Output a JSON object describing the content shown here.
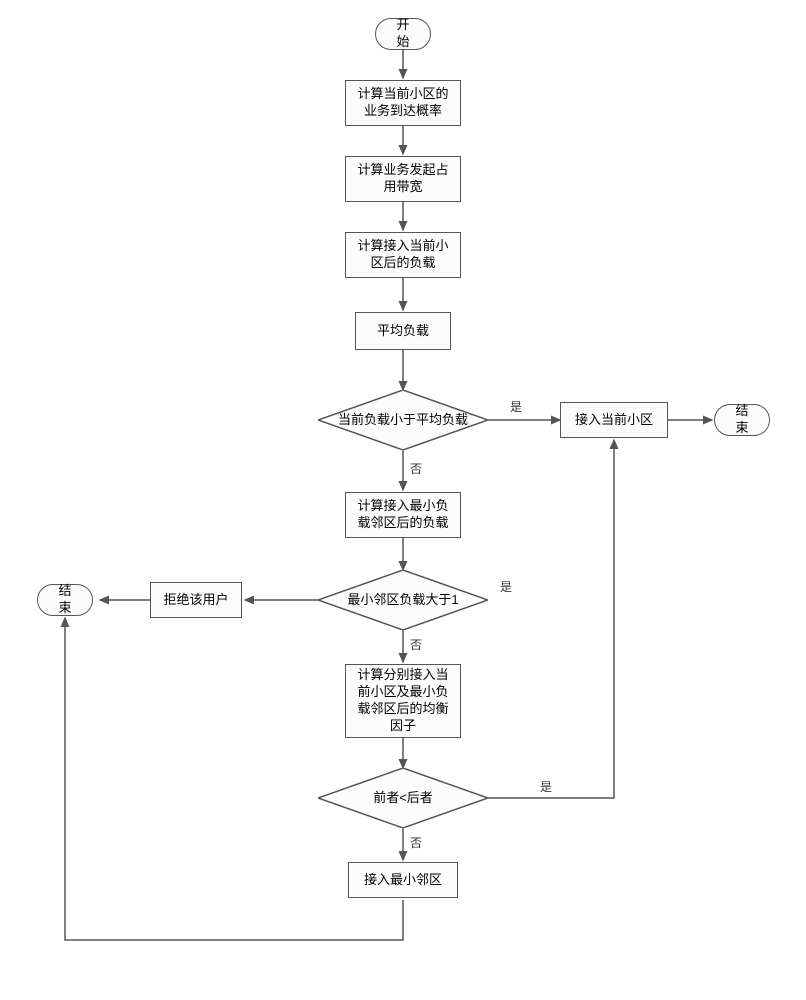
{
  "nodes": {
    "start": "开始",
    "calc_arrival_prob": "计算当前小区的业务到达概率",
    "calc_bandwidth": "计算业务发起占用带宽",
    "calc_load_after_access": "计算接入当前小区后的负载",
    "avg_load": "平均负载",
    "decision_avg": "当前负载小于平均负载",
    "access_current": "接入当前小区",
    "end1": "结束",
    "calc_min_neighbor_load": "计算接入最小负载邻区后的负载",
    "decision_min_neighbor_full": "最小邻区负载大于1",
    "reject_user": "拒绝该用户",
    "end2": "结束",
    "calc_balance_factor": "计算分别接入当前小区及最小负载邻区后的均衡因子",
    "decision_compare": "前者<后者",
    "access_min_neighbor": "接入最小邻区"
  },
  "labels": {
    "yes": "是",
    "no": "否"
  }
}
